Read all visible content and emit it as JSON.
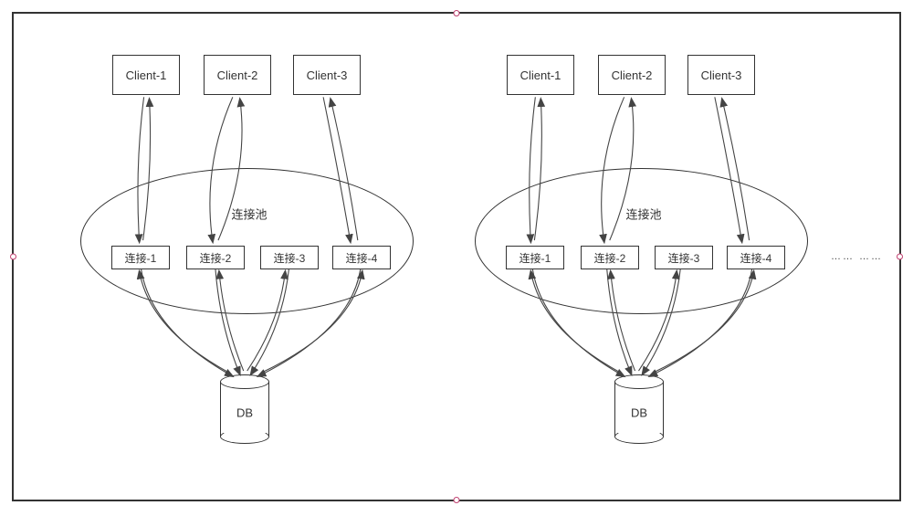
{
  "left": {
    "clients": [
      "Client-1",
      "Client-2",
      "Client-3"
    ],
    "pool_label": "连接池",
    "connections": [
      "连接-1",
      "连接-2",
      "连接-3",
      "连接-4"
    ],
    "db_label": "DB"
  },
  "right": {
    "clients": [
      "Client-1",
      "Client-2",
      "Client-3"
    ],
    "pool_label": "连接池",
    "connections": [
      "连接-1",
      "连接-2",
      "连接-3",
      "连接-4"
    ],
    "db_label": "DB"
  },
  "ellipsis": "……   ……"
}
